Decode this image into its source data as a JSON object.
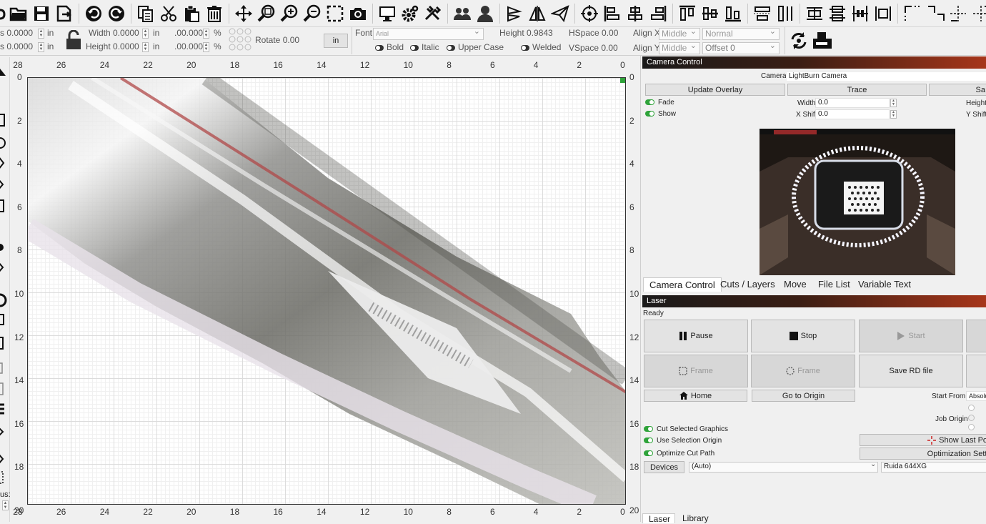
{
  "toolbar": {
    "icons": [
      "new-file-icon",
      "open-folder-icon",
      "save-icon",
      "save-as-icon",
      "undo-icon",
      "redo-icon",
      "copy-icon",
      "cut-icon",
      "paste-icon",
      "delete-icon",
      "move-icon",
      "zoom-selection-icon",
      "zoom-in-icon",
      "zoom-out-icon",
      "frame-select-icon",
      "camera-icon",
      "monitor-icon",
      "settings-icon",
      "tools-icon",
      "group-icon",
      "user-icon",
      "mirror-h-icon",
      "mirror-v-icon",
      "send-icon",
      "target-icon",
      "align-left-icon",
      "align-center-icon",
      "align-right-icon",
      "align-top-icon",
      "align-middle-icon",
      "align-bottom-icon",
      "distribute-h-icon",
      "distribute-v-icon",
      "space-h-icon",
      "space-v-icon",
      "move-together-icon",
      "center-icon",
      "corner-tl-icon",
      "corner-tr-icon",
      "corner-bl-icon",
      "corner-br-icon"
    ]
  },
  "props": {
    "x_label": "s 0.0000",
    "y_label": "s 0.0000",
    "unit": "in",
    "width_label": "Width 0.0000",
    "height_label": "Height 0.0000",
    "scale_w": ".00.000",
    "scale_h": ".00.000",
    "percent": "%",
    "rotate_label": "Rotate 0.00",
    "unit_button": "in",
    "font_label": "Font",
    "font_value": "Arial",
    "font_height": "Height 0.9843",
    "hspace": "HSpace 0.00",
    "vspace": "VSpace 0.00",
    "align_x": "Align X",
    "align_y": "Align Y",
    "align_x_value": "Middle",
    "align_y_value": "Middle",
    "style_value": "Normal",
    "offset": "Offset 0",
    "bold": "Bold",
    "italic": "Italic",
    "upper_case": "Upper Case",
    "welded": "Welded"
  },
  "ruler": {
    "top": [
      "28",
      "26",
      "24",
      "22",
      "20",
      "18",
      "16",
      "14",
      "12",
      "10",
      "8",
      "6",
      "4",
      "2",
      "0"
    ],
    "bottom": [
      "28",
      "26",
      "24",
      "22",
      "20",
      "18",
      "16",
      "14",
      "12",
      "10",
      "8",
      "6",
      "4",
      "2",
      "0"
    ],
    "left": [
      "0",
      "2",
      "4",
      "6",
      "8",
      "10",
      "12",
      "14",
      "16",
      "18",
      "20"
    ],
    "right": [
      "0",
      "2",
      "4",
      "6",
      "8",
      "10",
      "12",
      "14",
      "16",
      "18",
      "20"
    ]
  },
  "left_label": "us:",
  "camera": {
    "title": "Camera Control",
    "camera_label": "Camera:",
    "camera_value": "LightBurn Camera",
    "update_overlay": "Update Overlay",
    "trace": "Trace",
    "save_partial": "Sa",
    "fade": "Fade",
    "show": "Show",
    "width_label": "Width",
    "width_value": "0.0",
    "xshift_label": "X Shift",
    "xshift_value": "0.0",
    "height_label": "Height",
    "yshift_label": "Y Shift"
  },
  "tabs": [
    "Camera Control",
    "Cuts / Layers",
    "Move",
    "File List",
    "Variable Text"
  ],
  "laser": {
    "title": "Laser",
    "status": "Ready",
    "pause": "Pause",
    "stop": "Stop",
    "start": "Start",
    "frame1": "Frame",
    "frame2": "Frame",
    "save_rd": "Save RD file",
    "home": "Home",
    "go_origin": "Go to Origin",
    "start_from": "Start From:",
    "start_from_value": "Absolu",
    "job_origin": "Job Origin",
    "cut_selected": "Cut Selected Graphics",
    "use_selection_origin": "Use Selection Origin",
    "optimize_cut_path": "Optimize Cut Path",
    "show_last_position": "Show Last Posi",
    "optimization_settings": "Optimization Settin",
    "devices": "Devices",
    "devices_value": "(Auto)",
    "controller": "Ruida 644XG"
  },
  "bottom_tabs": [
    "Laser",
    "Library"
  ],
  "colors": {
    "accent_green": "#2fa33a",
    "title_dark": "#1a1a1a",
    "title_red": "#a8361a"
  }
}
